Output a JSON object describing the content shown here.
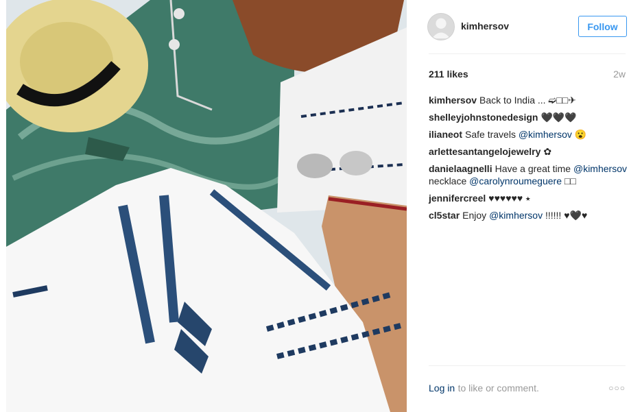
{
  "photo": {
    "alt": ""
  },
  "header": {
    "username": "kimhersov",
    "follow_label": "Follow"
  },
  "stats": {
    "likes": "211 likes",
    "time": "2w"
  },
  "comments": [
    {
      "author": "kimhersov",
      "text": "Back to India ... ➫□□✈"
    },
    {
      "author": "shelleyjohnstonedesign",
      "text": "🖤🖤🖤"
    },
    {
      "author": "ilianeot",
      "text": "Safe travels",
      "mention": "@kimhersov",
      "after": "😮"
    },
    {
      "author": "arlettesantangelojewelry",
      "text": "✿"
    },
    {
      "author": "danielaagnelli",
      "text": "Have a great time",
      "mention": "@kimhersov",
      "after": "necklace",
      "mention2": "@carolynroumeguere",
      "after2": "□□"
    },
    {
      "author": "jennifercreel",
      "text": "♥♥♥♥♥♥ ⭑"
    },
    {
      "author": "cl5star",
      "text": "Enjoy",
      "mention": "@kimhersov",
      "after": "!!!!!! ♥🖤♥"
    }
  ],
  "footer": {
    "login_label": "Log in",
    "login_rest": "to like or comment.",
    "more_label": "○○○"
  },
  "colors": {
    "accent": "#3897f0",
    "link": "#003569",
    "muted": "#999999"
  }
}
